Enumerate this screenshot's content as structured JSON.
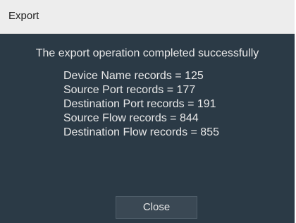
{
  "window": {
    "title": "Export"
  },
  "dialog": {
    "message": "The export operation completed successfully",
    "records": [
      "Device Name records = 125",
      "Source Port records = 177",
      "Destination Port records = 191",
      "Source Flow records = 844",
      "Destination Flow records = 855"
    ],
    "close_label": "Close"
  },
  "colors": {
    "dialog_background": "#2b3a46",
    "titlebar_background": "#ededed",
    "button_background": "#3a4854",
    "text": "#e8e8e8"
  }
}
